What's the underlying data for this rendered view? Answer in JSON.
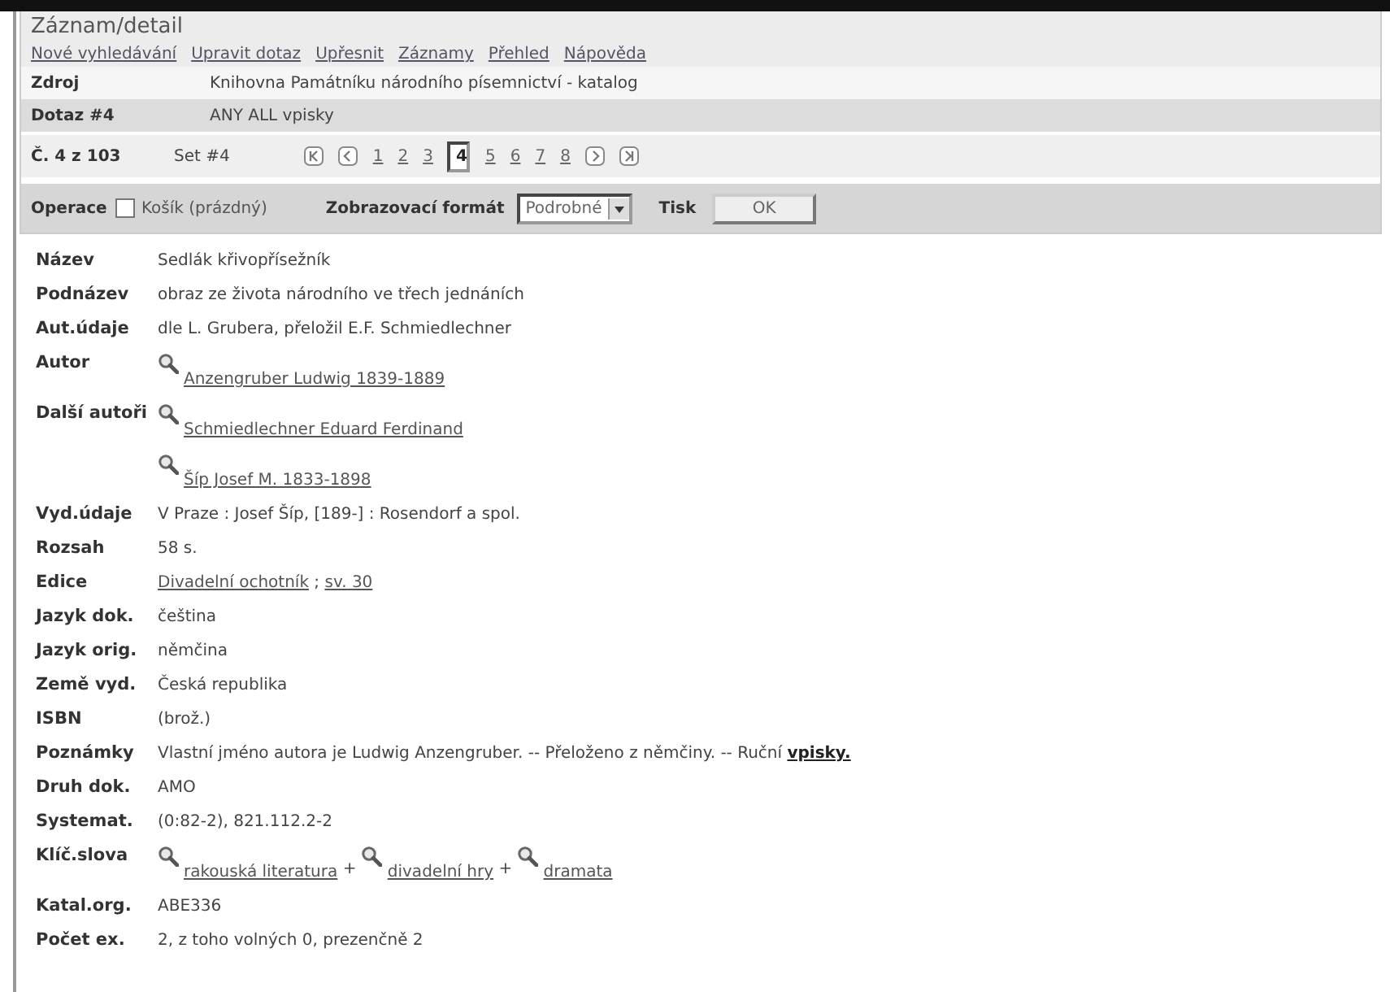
{
  "title": "Záznam/detail",
  "nav_links": [
    "Nové vyhledávání",
    "Upravit dotaz",
    "Upřesnit",
    "Záznamy",
    "Přehled",
    "Nápověda"
  ],
  "source": {
    "label": "Zdroj",
    "value": "Knihovna Památníku národního písemnictví - katalog"
  },
  "query": {
    "label": "Dotaz #4",
    "value": "ANY ALL vpisky"
  },
  "record_nav": {
    "position": "Č. 4 z 103",
    "set": "Set #4",
    "pages": [
      {
        "text": "1",
        "selected": false
      },
      {
        "text": "2",
        "selected": false
      },
      {
        "text": "3",
        "selected": false
      },
      {
        "text": "4",
        "selected": true
      },
      {
        "text": "5",
        "selected": false
      },
      {
        "text": "6",
        "selected": false
      },
      {
        "text": "7",
        "selected": false
      },
      {
        "text": "8",
        "selected": false
      }
    ]
  },
  "operations": {
    "label": "Operace",
    "cart": {
      "label": "Košík (prázdný)",
      "checked": false
    },
    "format_label": "Zobrazovací formát",
    "format": "Podrobné",
    "print_label": "Tisk",
    "ok_button": "OK"
  },
  "fields": [
    {
      "label": "Název",
      "items": [
        {
          "kind": "text",
          "text": "Sedlák křivopřísežník"
        }
      ]
    },
    {
      "label": "Podnázev",
      "items": [
        {
          "kind": "text",
          "text": "obraz ze života národního ve třech jednáních"
        }
      ]
    },
    {
      "label": "Aut.údaje",
      "items": [
        {
          "kind": "text",
          "text": "dle L. Grubera, přeložil E.F. Schmiedlechner"
        }
      ]
    },
    {
      "label": "Autor",
      "items": [
        {
          "kind": "search-link",
          "text": "Anzengruber Ludwig 1839-1889"
        }
      ]
    },
    {
      "label": "Další autoři",
      "items": [
        {
          "kind": "search-link",
          "text": "Schmiedlechner Eduard Ferdinand"
        }
      ]
    },
    {
      "items": [
        {
          "kind": "search-link",
          "text": "Šíp Josef M. 1833-1898"
        }
      ]
    },
    {
      "label": "Vyd.údaje",
      "items": [
        {
          "kind": "text",
          "text": "V Praze : Josef Šíp, [189-] : Rosendorf a spol."
        }
      ]
    },
    {
      "label": "Rozsah",
      "items": [
        {
          "kind": "text",
          "text": "58 s."
        }
      ]
    },
    {
      "label": "Edice",
      "items": [
        {
          "kind": "link",
          "text": "Divadelní ochotník"
        },
        {
          "kind": "text",
          "text": " ; "
        },
        {
          "kind": "link",
          "text": "sv. 30"
        }
      ]
    },
    {
      "label": "Jazyk dok.",
      "items": [
        {
          "kind": "text",
          "text": "čeština"
        }
      ]
    },
    {
      "label": "Jazyk orig.",
      "items": [
        {
          "kind": "text",
          "text": "němčina"
        }
      ]
    },
    {
      "label": "Země vyd.",
      "items": [
        {
          "kind": "text",
          "text": "Česká republika"
        }
      ]
    },
    {
      "label": "ISBN",
      "items": [
        {
          "kind": "text",
          "text": "(brož.)"
        }
      ]
    },
    {
      "label": "Poznámky",
      "items": [
        {
          "kind": "text",
          "text": "Vlastní jméno autora je Ludwig Anzengruber. -- Přeloženo z němčiny. -- Ruční "
        },
        {
          "kind": "bold-link",
          "text": "vpisky."
        }
      ]
    },
    {
      "label": "Druh dok.",
      "items": [
        {
          "kind": "text",
          "text": "AMO"
        }
      ]
    },
    {
      "label": "Systemat.",
      "items": [
        {
          "kind": "text",
          "text": "(0:82-2), 821.112.2-2"
        }
      ]
    },
    {
      "label": "Klíč.slova",
      "items": [
        {
          "kind": "search-link",
          "text": "rakouská literatura"
        },
        {
          "kind": "text",
          "text": " + "
        },
        {
          "kind": "search-link",
          "text": "divadelní hry"
        },
        {
          "kind": "text",
          "text": " + "
        },
        {
          "kind": "search-link",
          "text": "dramata"
        }
      ]
    },
    {
      "label": "Katal.org.",
      "items": [
        {
          "kind": "text",
          "text": "ABE336"
        }
      ]
    },
    {
      "label": "Počet ex.",
      "items": [
        {
          "kind": "text",
          "text": "2, z toho volných 0, prezenčně 2"
        }
      ]
    }
  ]
}
